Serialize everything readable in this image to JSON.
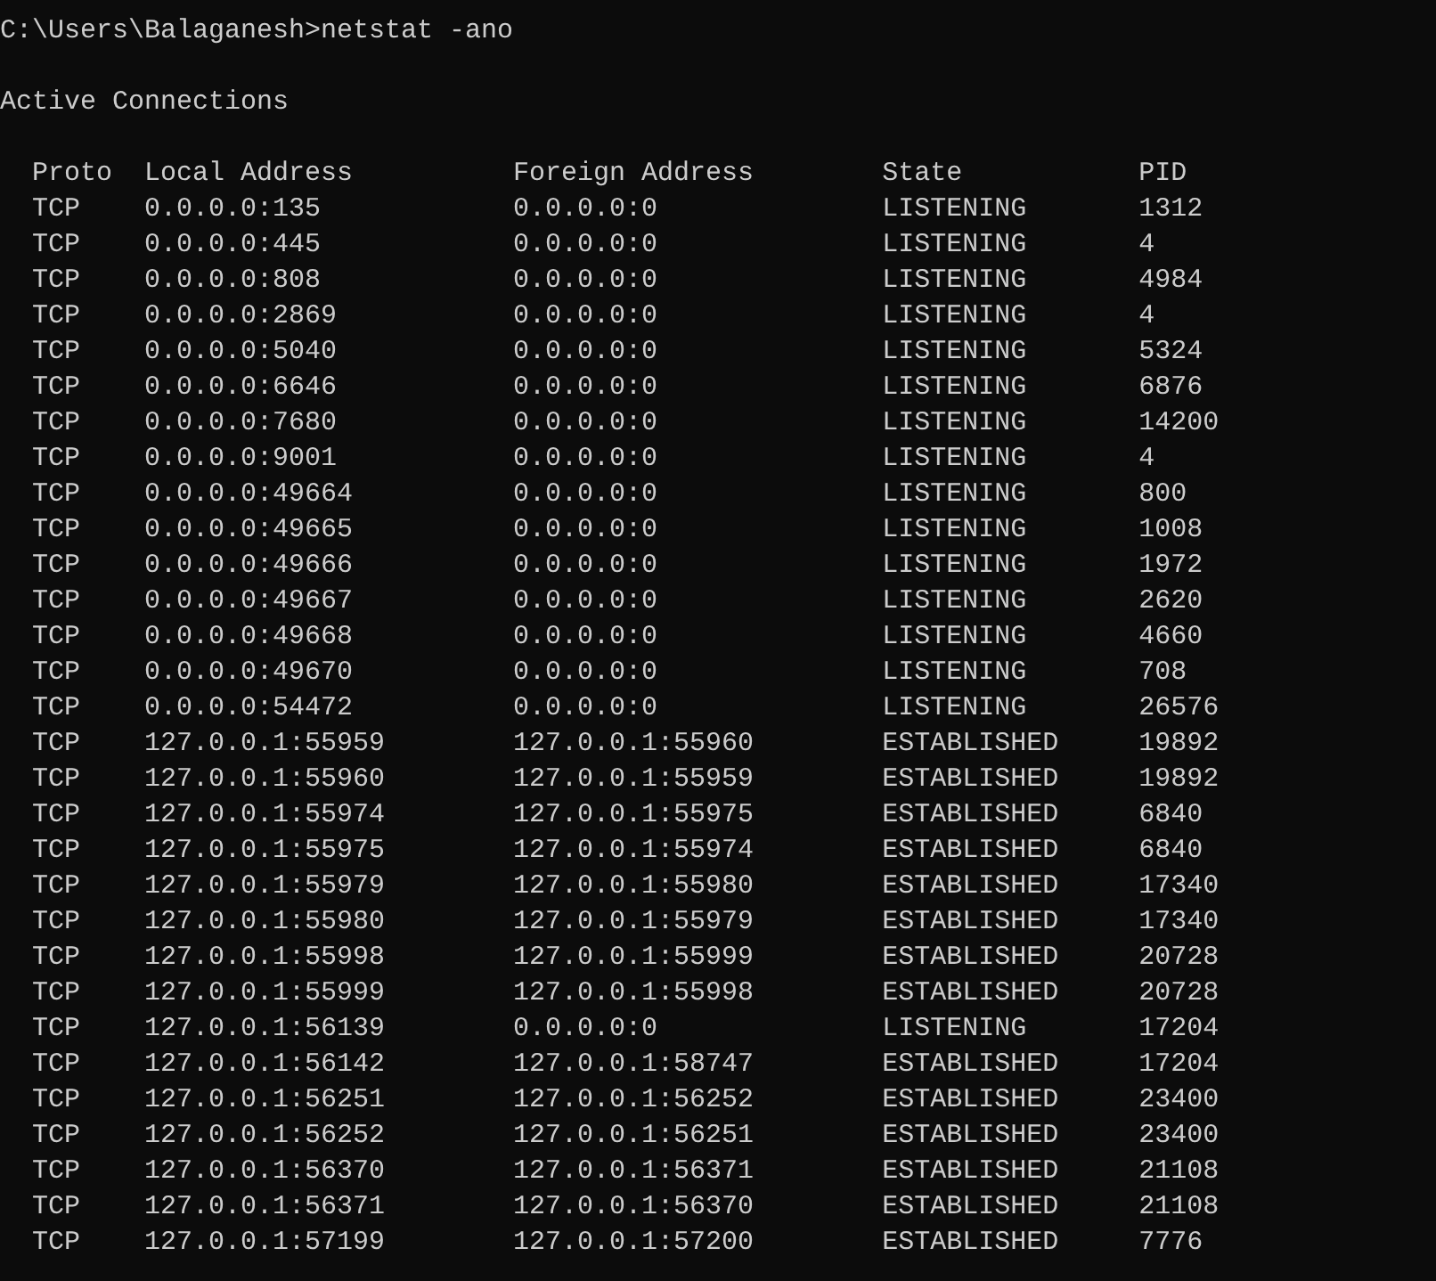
{
  "console": {
    "command_line": "C:\\Users\\Balaganesh>netstat -ano",
    "heading": "Active Connections",
    "columns": [
      "Proto",
      "Local Address",
      "Foreign Address",
      "State",
      "PID"
    ],
    "rows": [
      [
        "TCP",
        "0.0.0.0:135",
        "0.0.0.0:0",
        "LISTENING",
        "1312"
      ],
      [
        "TCP",
        "0.0.0.0:445",
        "0.0.0.0:0",
        "LISTENING",
        "4"
      ],
      [
        "TCP",
        "0.0.0.0:808",
        "0.0.0.0:0",
        "LISTENING",
        "4984"
      ],
      [
        "TCP",
        "0.0.0.0:2869",
        "0.0.0.0:0",
        "LISTENING",
        "4"
      ],
      [
        "TCP",
        "0.0.0.0:5040",
        "0.0.0.0:0",
        "LISTENING",
        "5324"
      ],
      [
        "TCP",
        "0.0.0.0:6646",
        "0.0.0.0:0",
        "LISTENING",
        "6876"
      ],
      [
        "TCP",
        "0.0.0.0:7680",
        "0.0.0.0:0",
        "LISTENING",
        "14200"
      ],
      [
        "TCP",
        "0.0.0.0:9001",
        "0.0.0.0:0",
        "LISTENING",
        "4"
      ],
      [
        "TCP",
        "0.0.0.0:49664",
        "0.0.0.0:0",
        "LISTENING",
        "800"
      ],
      [
        "TCP",
        "0.0.0.0:49665",
        "0.0.0.0:0",
        "LISTENING",
        "1008"
      ],
      [
        "TCP",
        "0.0.0.0:49666",
        "0.0.0.0:0",
        "LISTENING",
        "1972"
      ],
      [
        "TCP",
        "0.0.0.0:49667",
        "0.0.0.0:0",
        "LISTENING",
        "2620"
      ],
      [
        "TCP",
        "0.0.0.0:49668",
        "0.0.0.0:0",
        "LISTENING",
        "4660"
      ],
      [
        "TCP",
        "0.0.0.0:49670",
        "0.0.0.0:0",
        "LISTENING",
        "708"
      ],
      [
        "TCP",
        "0.0.0.0:54472",
        "0.0.0.0:0",
        "LISTENING",
        "26576"
      ],
      [
        "TCP",
        "127.0.0.1:55959",
        "127.0.0.1:55960",
        "ESTABLISHED",
        "19892"
      ],
      [
        "TCP",
        "127.0.0.1:55960",
        "127.0.0.1:55959",
        "ESTABLISHED",
        "19892"
      ],
      [
        "TCP",
        "127.0.0.1:55974",
        "127.0.0.1:55975",
        "ESTABLISHED",
        "6840"
      ],
      [
        "TCP",
        "127.0.0.1:55975",
        "127.0.0.1:55974",
        "ESTABLISHED",
        "6840"
      ],
      [
        "TCP",
        "127.0.0.1:55979",
        "127.0.0.1:55980",
        "ESTABLISHED",
        "17340"
      ],
      [
        "TCP",
        "127.0.0.1:55980",
        "127.0.0.1:55979",
        "ESTABLISHED",
        "17340"
      ],
      [
        "TCP",
        "127.0.0.1:55998",
        "127.0.0.1:55999",
        "ESTABLISHED",
        "20728"
      ],
      [
        "TCP",
        "127.0.0.1:55999",
        "127.0.0.1:55998",
        "ESTABLISHED",
        "20728"
      ],
      [
        "TCP",
        "127.0.0.1:56139",
        "0.0.0.0:0",
        "LISTENING",
        "17204"
      ],
      [
        "TCP",
        "127.0.0.1:56142",
        "127.0.0.1:58747",
        "ESTABLISHED",
        "17204"
      ],
      [
        "TCP",
        "127.0.0.1:56251",
        "127.0.0.1:56252",
        "ESTABLISHED",
        "23400"
      ],
      [
        "TCP",
        "127.0.0.1:56252",
        "127.0.0.1:56251",
        "ESTABLISHED",
        "23400"
      ],
      [
        "TCP",
        "127.0.0.1:56370",
        "127.0.0.1:56371",
        "ESTABLISHED",
        "21108"
      ],
      [
        "TCP",
        "127.0.0.1:56371",
        "127.0.0.1:56370",
        "ESTABLISHED",
        "21108"
      ],
      [
        "TCP",
        "127.0.0.1:57199",
        "127.0.0.1:57200",
        "ESTABLISHED",
        "7776"
      ]
    ]
  }
}
